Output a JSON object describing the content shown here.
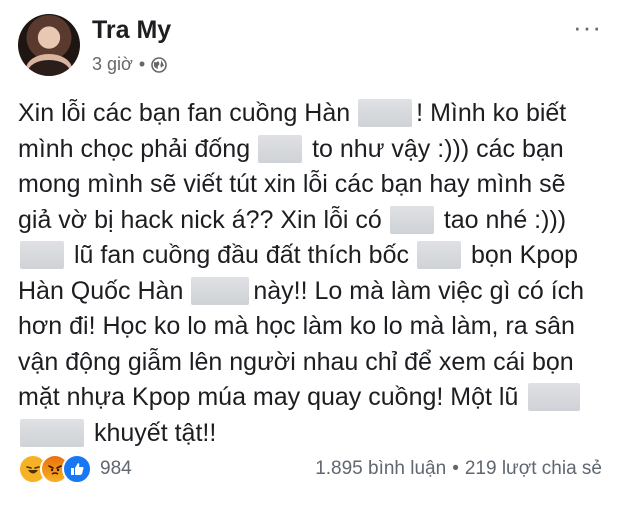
{
  "post": {
    "author": "Tra My",
    "time": "3 giờ",
    "separator": "•",
    "privacy_icon": "globe-icon",
    "more_icon": "more-options-icon",
    "more_glyph": "···",
    "lines": [
      [
        "Xin lỗi các bạn fan cuồng Hàn",
        "! Mình ko biết"
      ],
      [
        "mình chọc phải đống",
        "to như vậy :))) các bạn"
      ],
      [
        "mong mình sẽ viết tút xin lỗi các bạn hay mình sẽ"
      ],
      [
        "giả vờ bị hack nick á?? Xin lỗi có",
        "tao nhé :)))"
      ],
      [
        "",
        "lũ fan cuồng đầu đất thích bốc",
        "bọn Kpop"
      ],
      [
        "Hàn Quốc Hàn",
        "này!! Lo mà làm việc gì có ích"
      ],
      [
        "hơn đi! Học ko lo mà học làm ko lo mà làm, ra sân"
      ],
      [
        "vận động giẫm lên người nhau chỉ để xem cái bọn"
      ],
      [
        "mặt nhựa Kpop múa may quay cuồng! Một lũ",
        ""
      ],
      [
        "",
        "khuyết tật!!"
      ]
    ]
  },
  "footer": {
    "reactions": [
      "haha-icon",
      "angry-icon",
      "like-icon"
    ],
    "reaction_count": "984",
    "comments": "1.895 bình luận",
    "dot": "•",
    "shares": "219 lượt chia sẻ"
  }
}
